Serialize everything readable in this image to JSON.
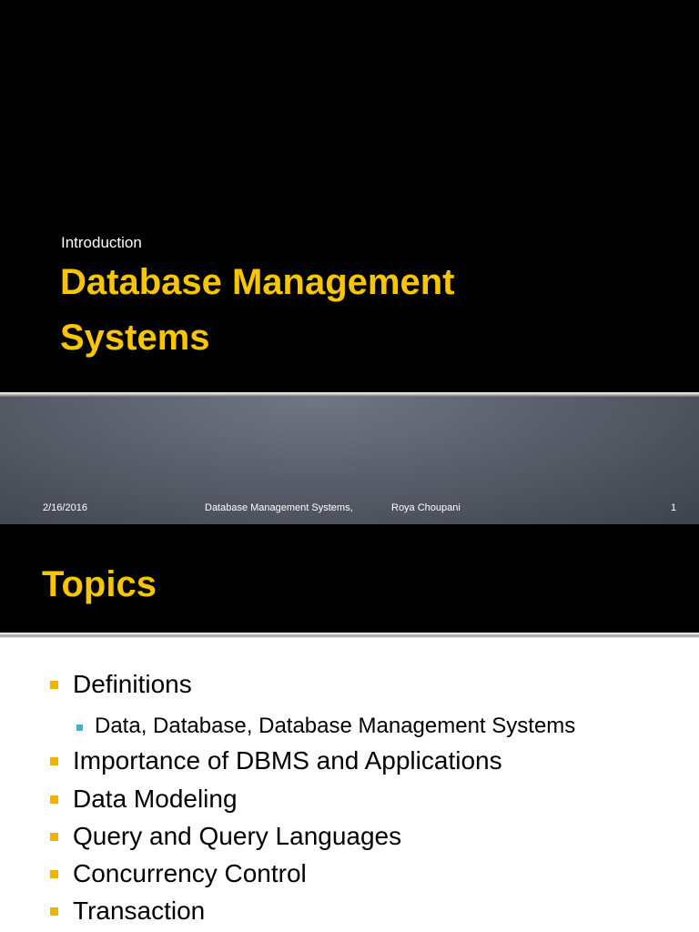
{
  "slide1": {
    "subtitle": "Introduction",
    "title_line1": "Database Management",
    "title_line2": "Systems",
    "footer": {
      "date": "2/16/2016",
      "course": "Database Management Systems,",
      "author": "Roya Choupani",
      "page": "1"
    }
  },
  "slide2": {
    "title": "Topics",
    "bullets": [
      {
        "label": "Definitions",
        "sub": [
          "Data, Database, Database Management Systems"
        ]
      },
      {
        "label": "Importance of DBMS and Applications"
      },
      {
        "label": "Data Modeling"
      },
      {
        "label": "Query and Query Languages"
      },
      {
        "label": "Concurrency Control"
      },
      {
        "label": "Transaction"
      }
    ]
  },
  "colors": {
    "title": "#f7c600",
    "bullet": "#f0b400",
    "sub_bullet": "#4bacc6"
  }
}
